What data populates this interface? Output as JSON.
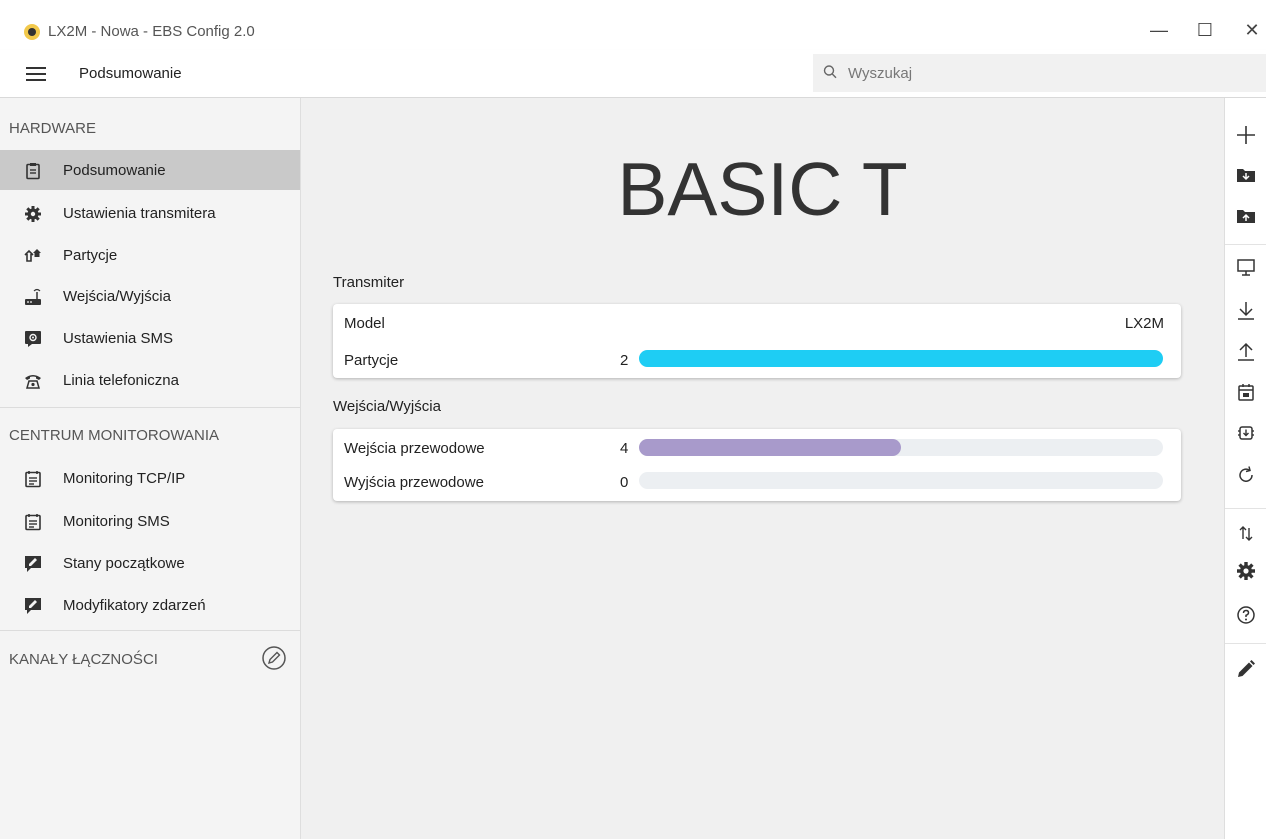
{
  "window": {
    "title": "LX2M - Nowa - EBS Config 2.0",
    "minimize_glyph": "—",
    "maximize_glyph": "☐",
    "close_glyph": "✕"
  },
  "toolbar": {
    "title": "Podsumowanie",
    "search_placeholder": "Wyszukaj"
  },
  "sidebar": {
    "hardware_header": "HARDWARE",
    "hardware_items": [
      {
        "label": "Podsumowanie",
        "icon": "clipboard-icon",
        "selected": true
      },
      {
        "label": "Ustawienia transmitera",
        "icon": "gear-icon"
      },
      {
        "label": "Partycje",
        "icon": "houses-icon"
      },
      {
        "label": "Wejścia/Wyjścia",
        "icon": "router-icon"
      },
      {
        "label": "Ustawienia SMS",
        "icon": "sms-settings-icon"
      },
      {
        "label": "Linia telefoniczna",
        "icon": "telephone-icon"
      }
    ],
    "monitoring_header": "CENTRUM MONITOROWANIA",
    "monitoring_items": [
      {
        "label": "Monitoring TCP/IP",
        "icon": "calendar-list-icon"
      },
      {
        "label": "Monitoring SMS",
        "icon": "calendar-list-icon"
      },
      {
        "label": "Stany początkowe",
        "icon": "edit-note-icon"
      },
      {
        "label": "Modyfikatory zdarzeń",
        "icon": "edit-note-icon"
      }
    ],
    "channels_header": "KANAŁY ŁĄCZNOŚCI"
  },
  "main": {
    "device_name": "BASIC T",
    "transmitter_group": "Transmiter",
    "model_label": "Model",
    "model_value": "LX2M",
    "partitions_label": "Partycje",
    "partitions_count": "2",
    "partitions_fill_fraction": 1.0,
    "io_group": "Wejścia/Wyjścia",
    "wired_inputs_label": "Wejścia przewodowe",
    "wired_inputs_count": "4",
    "wired_inputs_fill_fraction": 0.5,
    "wired_outputs_label": "Wyjścia przewodowe",
    "wired_outputs_count": "0",
    "wired_outputs_fill_fraction": 0.0
  },
  "colors": {
    "partitions_bar": "#1ecdf4",
    "inputs_bar": "#a89acb",
    "bar_track": "#eceff2"
  },
  "actions": [
    "add-icon",
    "folder-open-icon",
    "folder-save-icon",
    "monitor-icon",
    "download-icon",
    "upload-icon",
    "calendar-icon",
    "firmware-icon",
    "refresh-icon",
    "sort-icon",
    "gear-icon",
    "help-icon",
    "pencil-icon"
  ]
}
